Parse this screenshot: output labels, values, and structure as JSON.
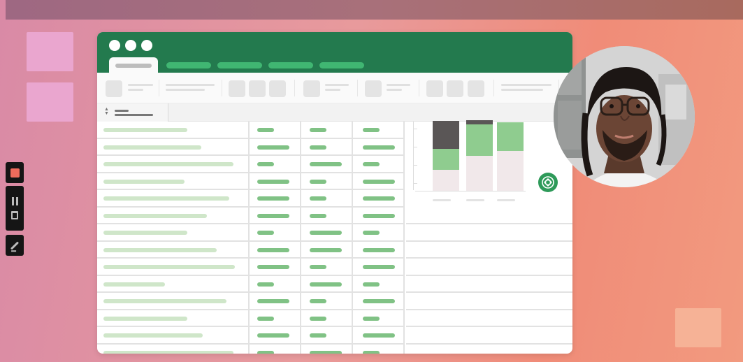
{
  "colors": {
    "brand_green": "#237a4e",
    "tab_green": "#40b672",
    "cell_bar_light": "#cfe6c9",
    "cell_bar_medium": "#80c285",
    "record_red": "#ef6c5c"
  },
  "recorder": {
    "controls": [
      {
        "name": "stop-recording-button",
        "icon": "stop-icon"
      },
      {
        "name": "pause-button",
        "icon": "pause-icon"
      },
      {
        "name": "delete-button",
        "icon": "trash-icon"
      },
      {
        "name": "draw-button",
        "icon": "pen-icon"
      }
    ]
  },
  "window": {
    "controls": [
      "close-dot",
      "minimize-dot",
      "maximize-dot"
    ],
    "tabs": [
      "tab-active",
      "tab-2",
      "tab-3",
      "tab-4",
      "tab-5"
    ],
    "grid": {
      "rows": 14,
      "columns": 4
    },
    "chart": {
      "type": "stacked-bar",
      "bars": 3,
      "segment_colors": [
        "#f1e8ea",
        "#8fcc8f",
        "#5a5656"
      ]
    },
    "badge_icon": "celtic-knot-icon"
  },
  "webcam": {
    "subject": "presenter"
  }
}
